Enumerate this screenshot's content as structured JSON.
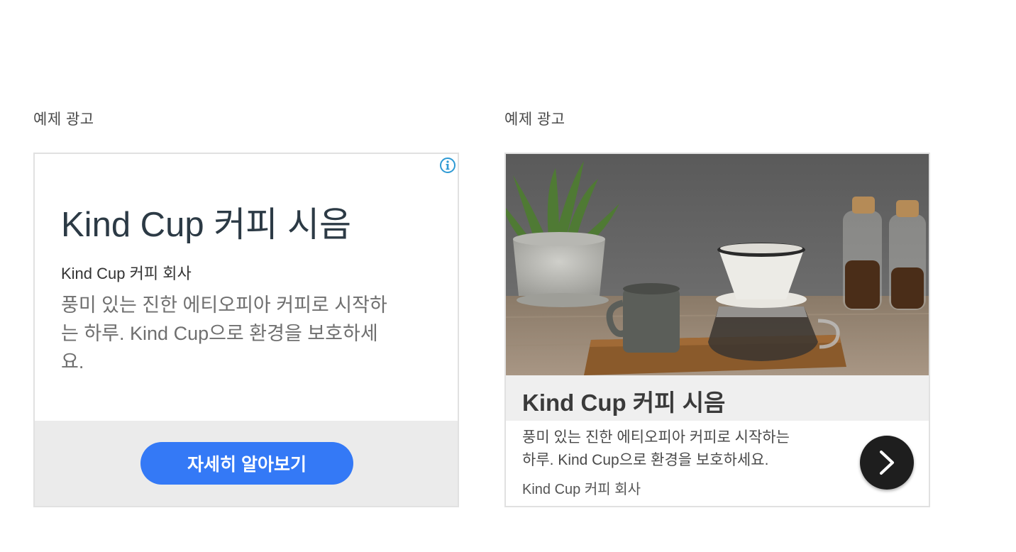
{
  "ads": [
    {
      "label": "예제 광고",
      "title": "Kind Cup 커피 시음",
      "advertiser": "Kind Cup 커피 회사",
      "description": "풍미 있는 진한 에티오피아 커피로 시작하는 하루. Kind Cup으로 환경을 보호하세요.",
      "cta_label": "자세히 알아보기",
      "icon": "info-icon"
    },
    {
      "label": "예제 광고",
      "title": "Kind Cup 커피 시음",
      "description": "풍미 있는 진한 에티오피아 커피로 시작하는 하루. Kind Cup으로 환경을 보호하세요.",
      "advertiser": "Kind Cup 커피 회사",
      "icon": "chevron-right-icon"
    }
  ],
  "colors": {
    "cta": "#3479f6",
    "title": "#2c3a45",
    "footer_bg": "#ebebeb",
    "next_button": "#1e1e1e"
  }
}
